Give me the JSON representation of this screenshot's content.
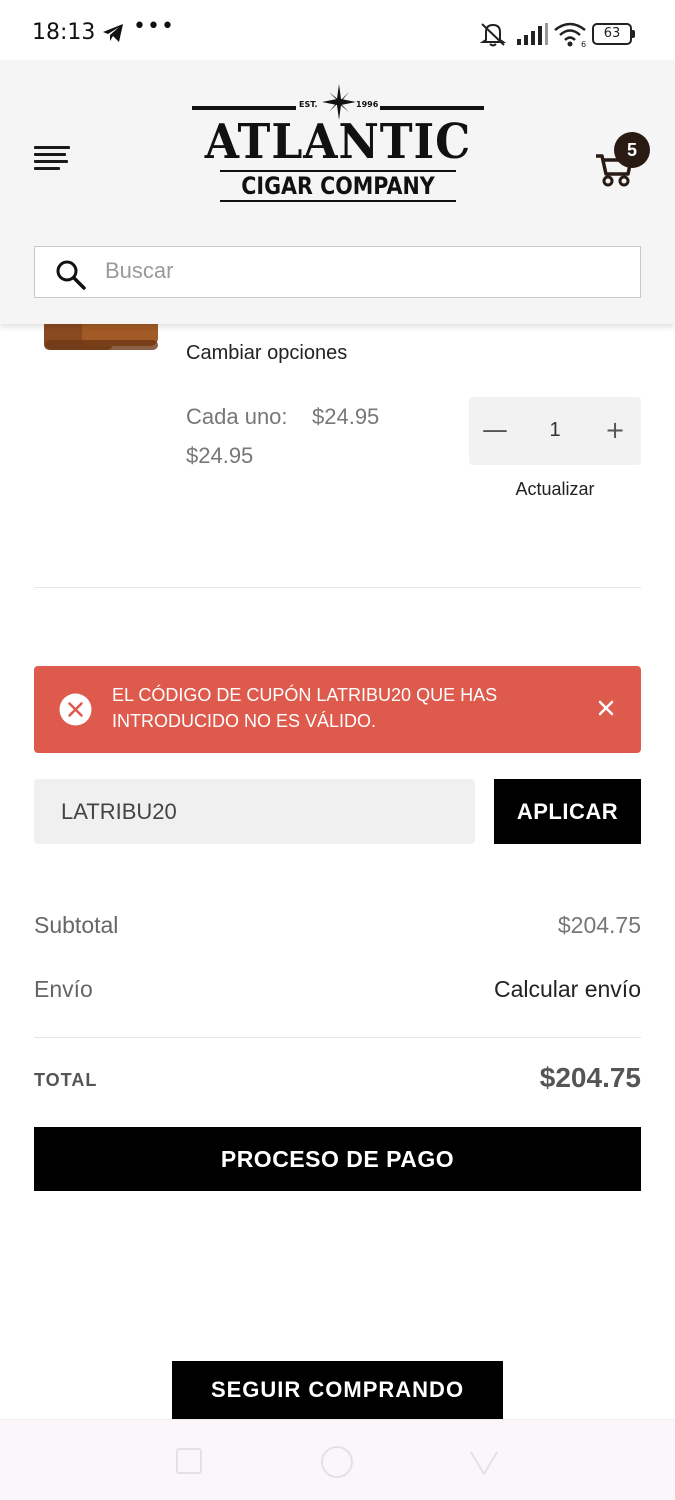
{
  "status_bar": {
    "time": "18:13",
    "more": "•••",
    "battery": "63",
    "icons": [
      "telegram-icon",
      "mute-icon",
      "signal-icon",
      "wifi-icon",
      "battery-icon"
    ]
  },
  "header": {
    "logo": {
      "est_left": "EST.",
      "est_right": "1996",
      "main": "ATLANTIC",
      "sub": "CIGAR COMPANY"
    },
    "cart_count": "5",
    "search_placeholder": "Buscar"
  },
  "cart_item": {
    "change_options": "Cambiar opciones",
    "each_label": "Cada uno:",
    "each_price": "$24.95",
    "line_price": "$24.95",
    "quantity": "1",
    "minus": "—",
    "plus": "+",
    "update_label": "Actualizar"
  },
  "alert": {
    "message": "EL CÓDIGO DE CUPÓN LATRIBU20 QUE HAS INTRODUCIDO NO ES VÁLIDO.",
    "color": "#dd5a4d"
  },
  "coupon": {
    "value": "LATRIBU20",
    "apply_label": "APLICAR"
  },
  "totals": {
    "subtotal_label": "Subtotal",
    "subtotal_value": "$204.75",
    "shipping_label": "Envío",
    "shipping_value": "Calcular envío",
    "total_label": "TOTAL",
    "total_value": "$204.75"
  },
  "buttons": {
    "checkout": "PROCESO DE PAGO",
    "continue_shopping": "SEGUIR COMPRANDO"
  },
  "colors": {
    "primary_button": "#000000",
    "header_bg": "#f5f5f5",
    "badge": "#2a1a14"
  }
}
